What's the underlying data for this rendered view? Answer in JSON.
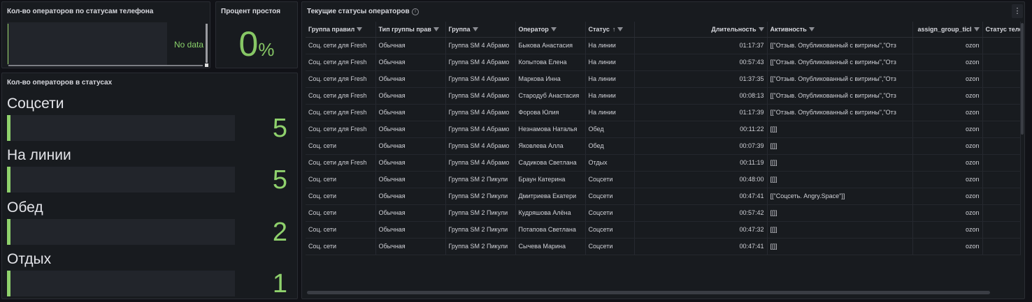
{
  "phone_panel": {
    "title": "Кол-во операторов по статусам телефона",
    "nodata": "No data"
  },
  "idle_panel": {
    "title": "Процент простоя",
    "value": "0",
    "unit": "%"
  },
  "status_panel": {
    "title": "Кол-во операторов в статусах",
    "bars": [
      {
        "label": "Соцсети",
        "value": "5",
        "fraction": 0.015
      },
      {
        "label": "На линии",
        "value": "5",
        "fraction": 0.015
      },
      {
        "label": "Обед",
        "value": "2",
        "fraction": 0.007
      },
      {
        "label": "Отдых",
        "value": "1",
        "fraction": 0.004
      }
    ],
    "accent_color": "#8fd16c"
  },
  "table_panel": {
    "title": "Текущие статусы операторов",
    "columns": [
      "Группа правил",
      "Тип группы прав",
      "Группа",
      "Оператор",
      "Статус",
      "Длительность",
      "Активность",
      "assign_group_ticl",
      "Статус теле"
    ],
    "sort_column": "Статус",
    "rows": [
      [
        "Соц. сети для Fresh",
        "Обычная",
        "Группа SM 4 Абрамо",
        "Быкова Анастасия",
        "На линии",
        "01:17:37",
        "[[\"Отзыв. Опубликованный с витрины\",\"Отз",
        "ozon",
        ""
      ],
      [
        "Соц. сети для Fresh",
        "Обычная",
        "Группа SM 4 Абрамо",
        "Копытова Елена",
        "На линии",
        "00:57:43",
        "[[\"Отзыв. Опубликованный с витрины\",\"Отз",
        "ozon",
        ""
      ],
      [
        "Соц. сети для Fresh",
        "Обычная",
        "Группа SM 4 Абрамо",
        "Маркова Инна",
        "На линии",
        "01:37:35",
        "[[\"Отзыв. Опубликованный с витрины\",\"Отз",
        "ozon",
        ""
      ],
      [
        "Соц. сети для Fresh",
        "Обычная",
        "Группа SM 4 Абрамо",
        "Стародуб Анастасия",
        "На линии",
        "00:08:13",
        "[[\"Отзыв. Опубликованный с витрины\",\"Отз",
        "ozon",
        ""
      ],
      [
        "Соц. сети для Fresh",
        "Обычная",
        "Группа SM 4 Абрамо",
        "Форова Юлия",
        "На линии",
        "01:17:39",
        "[[\"Отзыв. Опубликованный с витрины\",\"Отз",
        "ozon",
        ""
      ],
      [
        "Соц. сети для Fresh",
        "Обычная",
        "Группа SM 4 Абрамо",
        "Незнамова Наталья",
        "Обед",
        "00:11:22",
        "[[]]",
        "ozon",
        ""
      ],
      [
        "Соц. сети",
        "Обычная",
        "Группа SM 4 Абрамо",
        "Яковлева Алла",
        "Обед",
        "00:07:39",
        "[[]]",
        "ozon",
        ""
      ],
      [
        "Соц. сети для Fresh",
        "Обычная",
        "Группа SM 4 Абрамо",
        "Садикова Светлана",
        "Отдых",
        "00:11:19",
        "[[]]",
        "ozon",
        ""
      ],
      [
        "Соц. сети",
        "Обычная",
        "Группа SM 2 Пикули",
        "Браун Катерина",
        "Соцсети",
        "00:48:00",
        "[[]]",
        "ozon",
        ""
      ],
      [
        "Соц. сети",
        "Обычная",
        "Группа SM 2 Пикули",
        "Дмитриева Екатери",
        "Соцсети",
        "00:47:41",
        "[[\"Соцсеть. Angry.Space\"]]",
        "ozon",
        ""
      ],
      [
        "Соц. сети",
        "Обычная",
        "Группа SM 2 Пикули",
        "Кудряшова Алёна",
        "Соцсети",
        "00:57:42",
        "[[]]",
        "ozon",
        ""
      ],
      [
        "Соц. сети",
        "Обычная",
        "Группа SM 2 Пикули",
        "Потапова Светлана",
        "Соцсети",
        "00:47:32",
        "[[]]",
        "ozon",
        ""
      ],
      [
        "Соц. сети",
        "Обычная",
        "Группа SM 2 Пикули",
        "Сычева Марина",
        "Соцсети",
        "00:47:41",
        "[[]]",
        "ozon",
        ""
      ]
    ]
  },
  "icons": {
    "info": "info-icon",
    "menu": "kebab-menu-icon",
    "filter": "filter-icon",
    "sort": "sort-ascending-icon"
  }
}
